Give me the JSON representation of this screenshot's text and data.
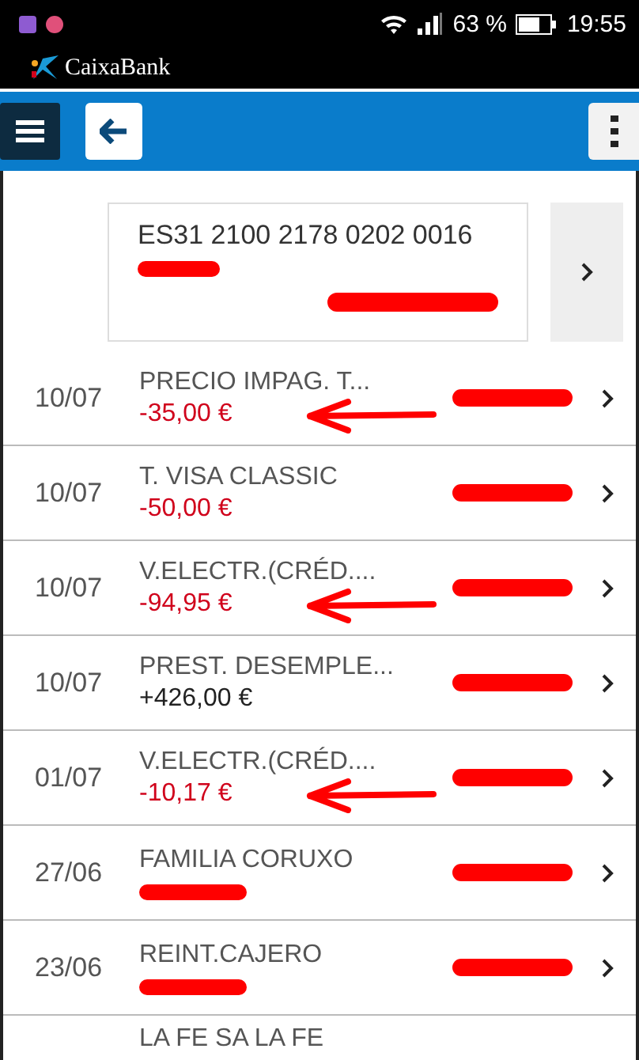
{
  "status_bar": {
    "battery": "63 %",
    "time": "19:55"
  },
  "app_header": {
    "brand": "CaixaBank"
  },
  "account": {
    "iban": "ES31 2100 2178 0202 0016",
    "holder_redacted": true,
    "balance_redacted": true
  },
  "movements": [
    {
      "date": "10/07",
      "concept": "PRECIO IMPAG. T...",
      "amount": {
        "text": "-35,00 €",
        "negative": true
      },
      "balance_redacted": true,
      "annotated": true
    },
    {
      "date": "10/07",
      "concept": "T. VISA CLASSIC",
      "amount": {
        "text": "-50,00 €",
        "negative": true
      },
      "balance_redacted": true,
      "annotated": false
    },
    {
      "date": "10/07",
      "concept": "V.ELECTR.(CRÉD....",
      "amount": {
        "text": "-94,95 €",
        "negative": true
      },
      "balance_redacted": true,
      "annotated": true
    },
    {
      "date": "10/07",
      "concept": "PREST. DESEMPLE...",
      "amount": {
        "text": "+426,00 €",
        "negative": false
      },
      "balance_redacted": true,
      "annotated": false
    },
    {
      "date": "01/07",
      "concept": "V.ELECTR.(CRÉD....",
      "amount": {
        "text": "-10,17 €",
        "negative": true
      },
      "balance_redacted": true,
      "annotated": true
    },
    {
      "date": "27/06",
      "concept": "FAMILIA CORUXO",
      "amount": {
        "redacted": true
      },
      "balance_redacted": true,
      "annotated": false
    },
    {
      "date": "23/06",
      "concept": "REINT.CAJERO",
      "amount": {
        "redacted": true
      },
      "balance_redacted": true,
      "annotated": false
    },
    {
      "concept": "LA FE SA LA FE"
    }
  ]
}
